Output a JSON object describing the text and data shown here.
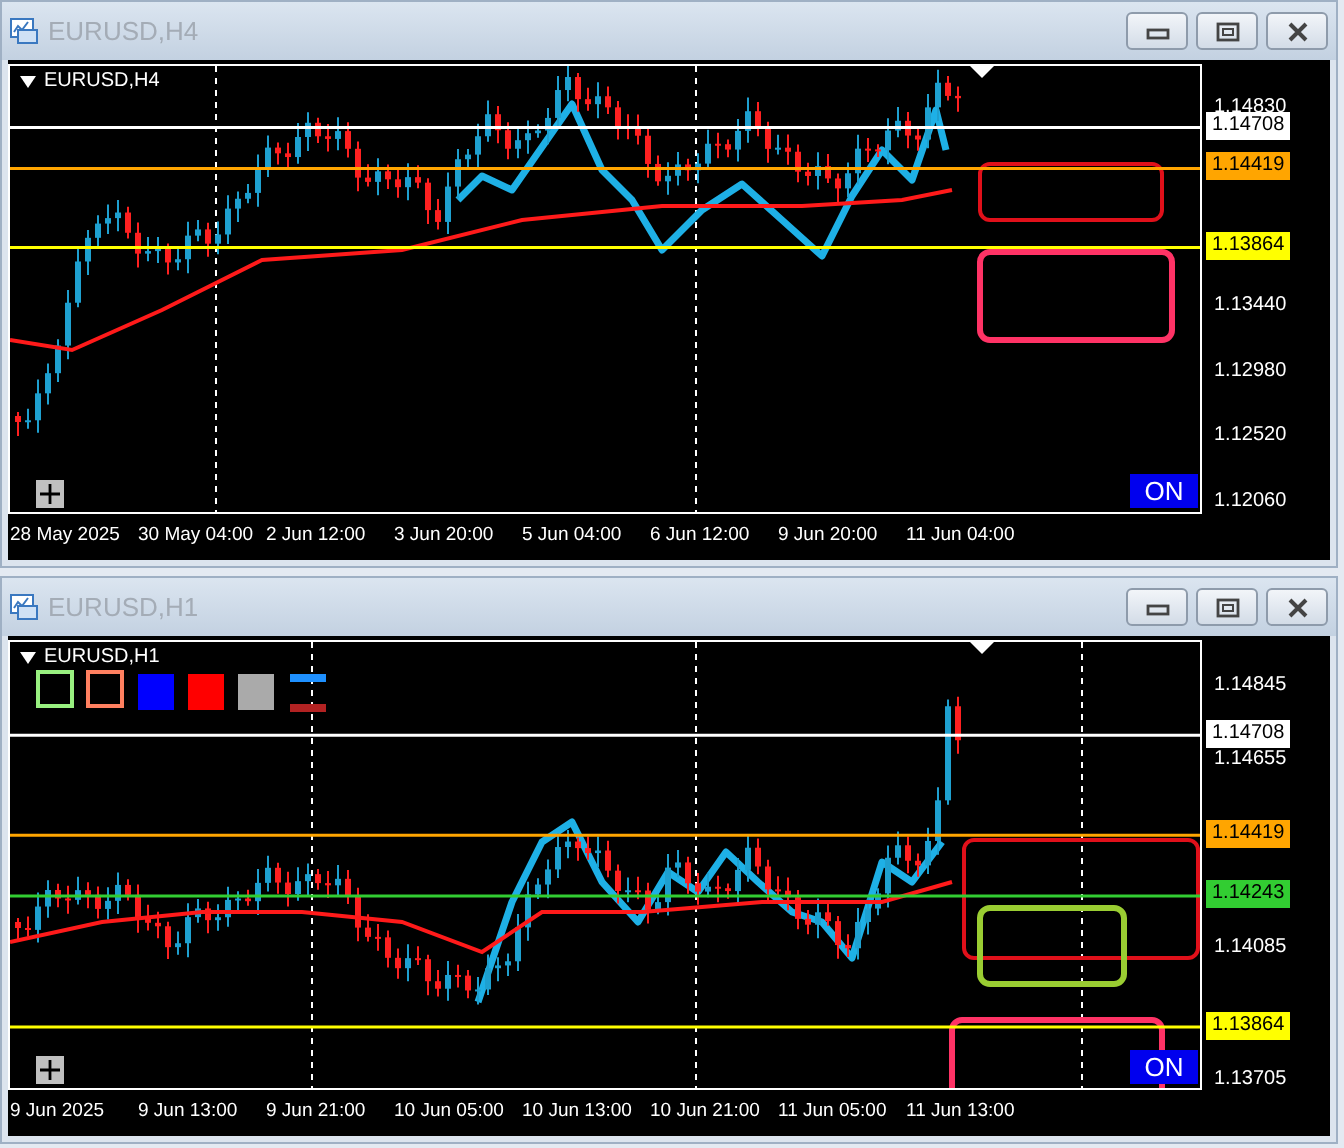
{
  "windows": [
    {
      "kind": "h4",
      "title": "EURUSD,H4",
      "chart_label": "EURUSD,H4",
      "price_ticks": [
        "1.14830",
        "1.13440",
        "1.12980",
        "1.12520",
        "1.12060"
      ],
      "price_tags": [
        {
          "value": "1.14708",
          "color": "#ffffff"
        },
        {
          "value": "1.14419",
          "color": "#ffa500"
        },
        {
          "value": "1.13864",
          "color": "#ffff00"
        }
      ],
      "time_labels": [
        "28 May 2025",
        "30 May 04:00",
        "2 Jun 12:00",
        "3 Jun 20:00",
        "5 Jun 04:00",
        "6 Jun 12:00",
        "9 Jun 20:00",
        "11 Jun 04:00"
      ],
      "toggle_label": "ON"
    },
    {
      "kind": "h1",
      "title": "EURUSD,H1",
      "chart_label": "EURUSD,H1",
      "price_ticks": [
        "1.14845",
        "1.14655",
        "1.14085",
        "1.13705"
      ],
      "price_tags": [
        {
          "value": "1.14708",
          "color": "#ffffff"
        },
        {
          "value": "1.14419",
          "color": "#ffa500"
        },
        {
          "value": "1.14243",
          "color": "#32cd32"
        },
        {
          "value": "1.13864",
          "color": "#ffff00"
        }
      ],
      "time_labels": [
        "9 Jun 2025",
        "9 Jun 13:00",
        "9 Jun 21:00",
        "10 Jun 05:00",
        "10 Jun 13:00",
        "10 Jun 21:00",
        "11 Jun 05:00",
        "11 Jun 13:00"
      ],
      "toggle_label": "ON"
    }
  ]
}
